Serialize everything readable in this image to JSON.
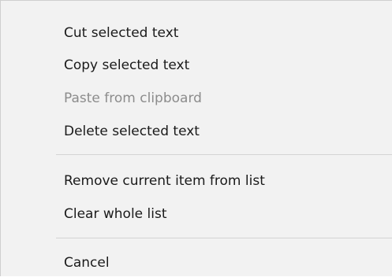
{
  "context_menu": {
    "items": [
      {
        "label": "Cut selected text",
        "enabled": true
      },
      {
        "label": "Copy selected text",
        "enabled": true
      },
      {
        "label": "Paste from clipboard",
        "enabled": false
      },
      {
        "label": "Delete selected text",
        "enabled": true
      },
      {
        "label": "Remove current item from list",
        "enabled": true
      },
      {
        "label": "Clear whole list",
        "enabled": true
      },
      {
        "label": "Cancel",
        "enabled": true
      }
    ]
  }
}
